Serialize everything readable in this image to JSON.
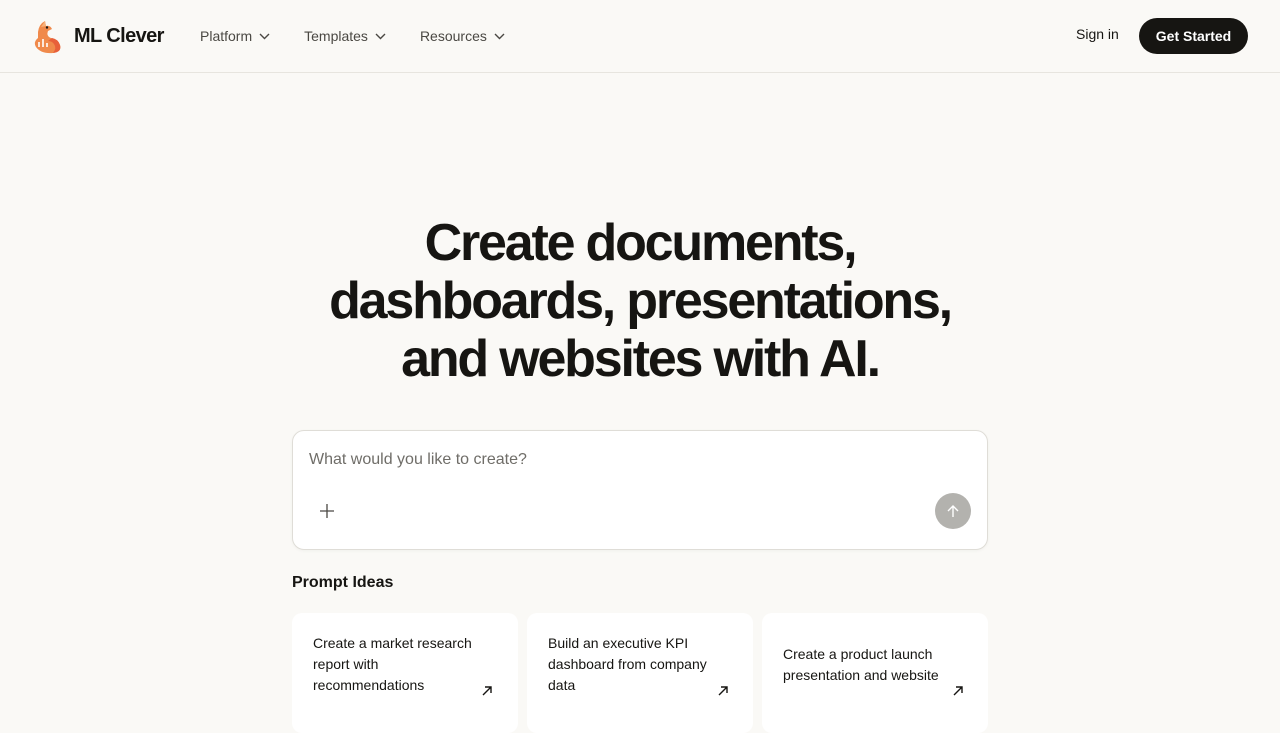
{
  "brand": {
    "name": "ML Clever"
  },
  "nav": {
    "items": [
      {
        "label": "Platform"
      },
      {
        "label": "Templates"
      },
      {
        "label": "Resources"
      }
    ],
    "sign_in": "Sign in",
    "get_started": "Get Started"
  },
  "hero": {
    "line1": "Create documents,",
    "line2": "dashboards, presentations,",
    "line3": "and websites with AI."
  },
  "prompt": {
    "placeholder": "What would you like to create?",
    "value": ""
  },
  "ideas": {
    "title": "Prompt Ideas",
    "cards": [
      {
        "text": "Create a market research report with recommendations"
      },
      {
        "text": "Build an executive KPI dashboard from company data"
      },
      {
        "text": "Create a product launch presentation and website"
      }
    ]
  },
  "colors": {
    "background": "#faf9f6",
    "text": "#161512",
    "cta": "#161512",
    "send_disabled": "#b3b2ae",
    "logo_orange": "#f08a4b"
  },
  "icons": {
    "logo": "fox-logo-icon",
    "dropdown": "chevron-down-icon",
    "attach": "plus-icon",
    "send": "arrow-up-icon",
    "card": "arrow-up-right-icon"
  }
}
